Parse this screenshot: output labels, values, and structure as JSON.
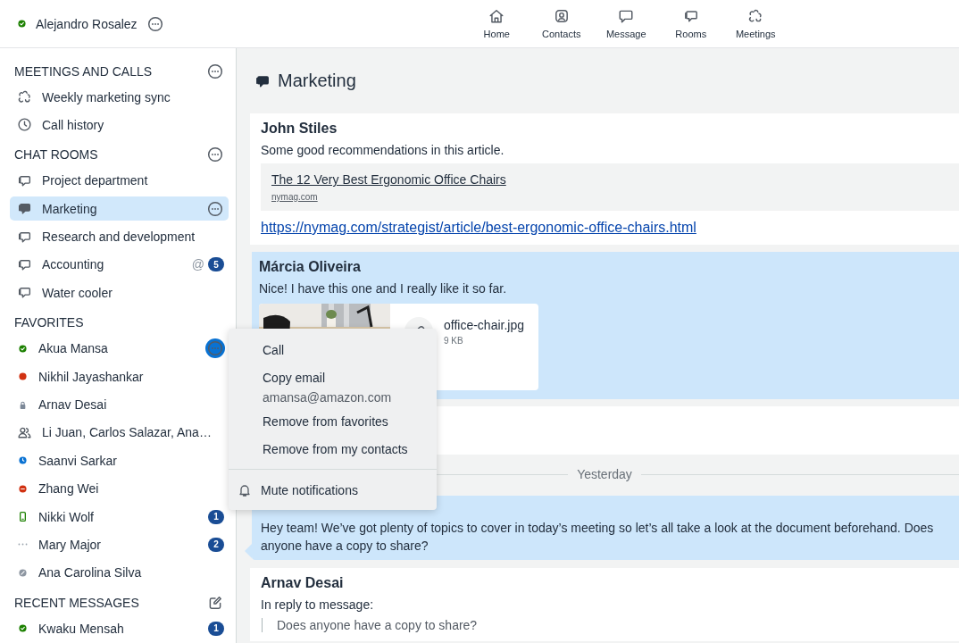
{
  "user": {
    "name": "Alejandro Rosalez",
    "kind": "online"
  },
  "nav": [
    {
      "label": "Home",
      "kind": "home"
    },
    {
      "label": "Contacts",
      "kind": "contacts"
    },
    {
      "label": "Message",
      "kind": "message"
    },
    {
      "label": "Rooms",
      "kind": "rooms"
    },
    {
      "label": "Meetings",
      "kind": "meeting"
    }
  ],
  "sidebar": {
    "sections": [
      {
        "title": "MEETINGS AND CALLS",
        "kind": "more",
        "items": [
          {
            "label": "Weekly marketing sync",
            "kind": "meeting",
            "selected": false,
            "menu_open": false
          },
          {
            "label": "Call history",
            "kind": "history",
            "selected": false,
            "menu_open": false
          }
        ]
      },
      {
        "title": "CHAT ROOMS",
        "kind": "more",
        "items": [
          {
            "label": "Project department",
            "kind": "room",
            "selected": false,
            "menu_open": false
          },
          {
            "label": "Marketing",
            "kind": "room",
            "selected": true,
            "menu_open": false
          },
          {
            "label": "Research and development",
            "kind": "room",
            "selected": false,
            "menu_open": false
          },
          {
            "label": "Accounting",
            "kind": "room",
            "selected": false,
            "menu_open": false,
            "mention": "@",
            "badge": "5"
          },
          {
            "label": "Water cooler",
            "kind": "room",
            "selected": false,
            "menu_open": false
          }
        ]
      },
      {
        "title": "FAVORITES",
        "kind": "plain",
        "items": [
          {
            "label": "Akua Mansa",
            "kind": "online",
            "selected": false,
            "menu_open": true
          },
          {
            "label": "Nikhil Jayashankar",
            "kind": "busy",
            "selected": false,
            "menu_open": false
          },
          {
            "label": "Arnav Desai",
            "kind": "locked",
            "selected": false,
            "menu_open": false
          },
          {
            "label": "Li Juan, Carlos Salazar, Ana…",
            "kind": "group",
            "selected": false,
            "menu_open": false
          },
          {
            "label": "Saanvi Sarkar",
            "kind": "away",
            "selected": false,
            "menu_open": false
          },
          {
            "label": "Zhang Wei",
            "kind": "dnd",
            "selected": false,
            "menu_open": false
          },
          {
            "label": "Nikki Wolf",
            "kind": "mobile",
            "selected": false,
            "menu_open": false,
            "badge": "1"
          },
          {
            "label": "Mary Major",
            "kind": "idle",
            "selected": false,
            "menu_open": false,
            "badge": "2"
          },
          {
            "label": "Ana Carolina Silva",
            "kind": "offline",
            "selected": false,
            "menu_open": false
          }
        ]
      },
      {
        "title": "RECENT MESSAGES",
        "kind": "compose",
        "items": [
          {
            "label": "Kwaku Mensah",
            "kind": "online",
            "selected": false,
            "menu_open": false,
            "badge": "1"
          }
        ]
      }
    ]
  },
  "room": {
    "title": "Marketing"
  },
  "messages": [
    {
      "kind": "message",
      "highlighted": false,
      "sender": "John Stiles",
      "text": "Some good recommendations in this article.",
      "link_preview": {
        "title": "The 12 Very Best Ergonomic Office Chairs",
        "site": "nymag.com"
      },
      "link": "https://nymag.com/strategist/article/best-ergonomic-office-chairs.html"
    },
    {
      "kind": "message",
      "highlighted": true,
      "sender": "Márcia Oliveira",
      "text": "Nice! I have this one and I really like it so far.",
      "attachment": {
        "name": "office-chair.jpg",
        "size": "9 KB"
      }
    },
    {
      "kind": "message",
      "highlighted": false
    },
    {
      "kind": "date",
      "label": "Yesterday"
    },
    {
      "kind": "bubble",
      "text": "Hey team! We’ve got plenty of topics to cover in today’s meeting so let’s all take a look at the document beforehand. Does anyone have a copy to share?"
    },
    {
      "kind": "message",
      "highlighted": false,
      "sender": "Arnav Desai",
      "reply_label": "In reply to message:",
      "quote": "Does anyone have a copy to share?"
    }
  ],
  "context_menu": {
    "groups": [
      [
        {
          "label": "Call",
          "kind": "action"
        },
        {
          "label": "Copy email",
          "kind": "action"
        },
        {
          "label": "amansa@amazon.com",
          "kind": "detail"
        },
        {
          "label": "Remove from favorites",
          "kind": "action"
        },
        {
          "label": "Remove from my contacts",
          "kind": "action"
        }
      ],
      [
        {
          "label": "Mute notifications",
          "kind": "bell"
        }
      ]
    ]
  }
}
